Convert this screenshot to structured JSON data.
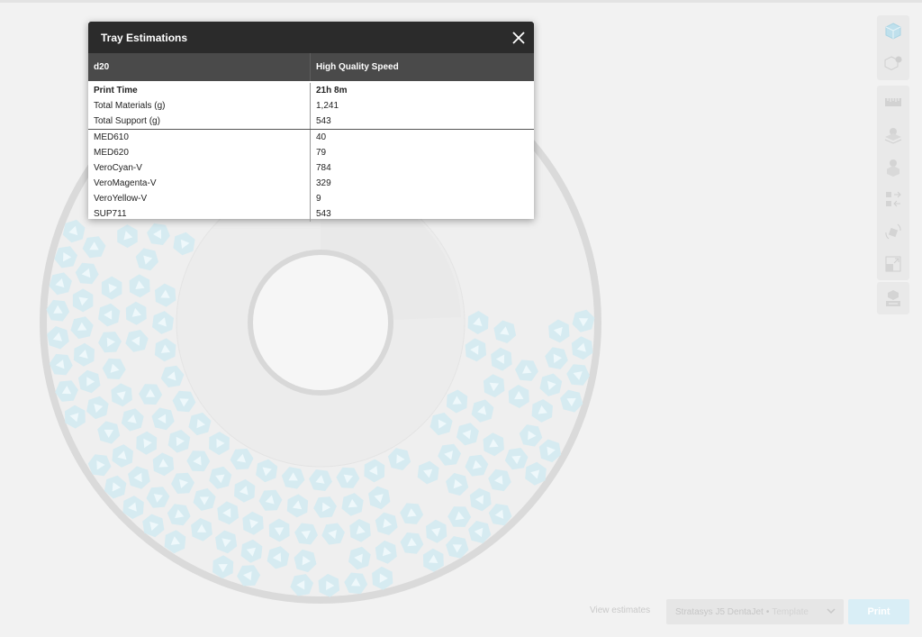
{
  "dialog": {
    "title": "Tray Estimations",
    "columns": [
      "d20",
      "High Quality Speed"
    ],
    "summary_rows": [
      {
        "label": "Print Time",
        "value": "21h 8m",
        "bold": true
      },
      {
        "label": "Total Materials (g)",
        "value": "1,241"
      },
      {
        "label": "Total Support (g)",
        "value": "543"
      }
    ],
    "material_rows": [
      {
        "label": "MED610",
        "value": "40"
      },
      {
        "label": "MED620",
        "value": "79"
      },
      {
        "label": "VeroCyan-V",
        "value": "784"
      },
      {
        "label": "VeroMagenta-V",
        "value": "329"
      },
      {
        "label": "VeroYellow-V",
        "value": "9"
      },
      {
        "label": "SUP711",
        "value": "543"
      }
    ]
  },
  "toolbar": {
    "groups": [
      [
        "cube-icon",
        "cube-check-icon"
      ],
      [
        "ruler-icon",
        "layer-settings-icon",
        "gear-cube-icon",
        "arrange-icon",
        "rotate-icon",
        "scale-icon"
      ],
      [
        "cube-keyboard-icon"
      ]
    ]
  },
  "footer": {
    "view_estimates": "View estimates",
    "printer_name": "Stratasys J5 DentaJet",
    "separator": "•",
    "printer_template": "Template",
    "print_label": "Print"
  },
  "colors": {
    "dialog_header": "#2b2b2b",
    "table_header": "#4a4a4a",
    "part_fill": "#d6ebf1",
    "part_glyph": "#eef8fb",
    "tray_ring": "#d9d9d9",
    "print_button": "#d9eef6"
  }
}
